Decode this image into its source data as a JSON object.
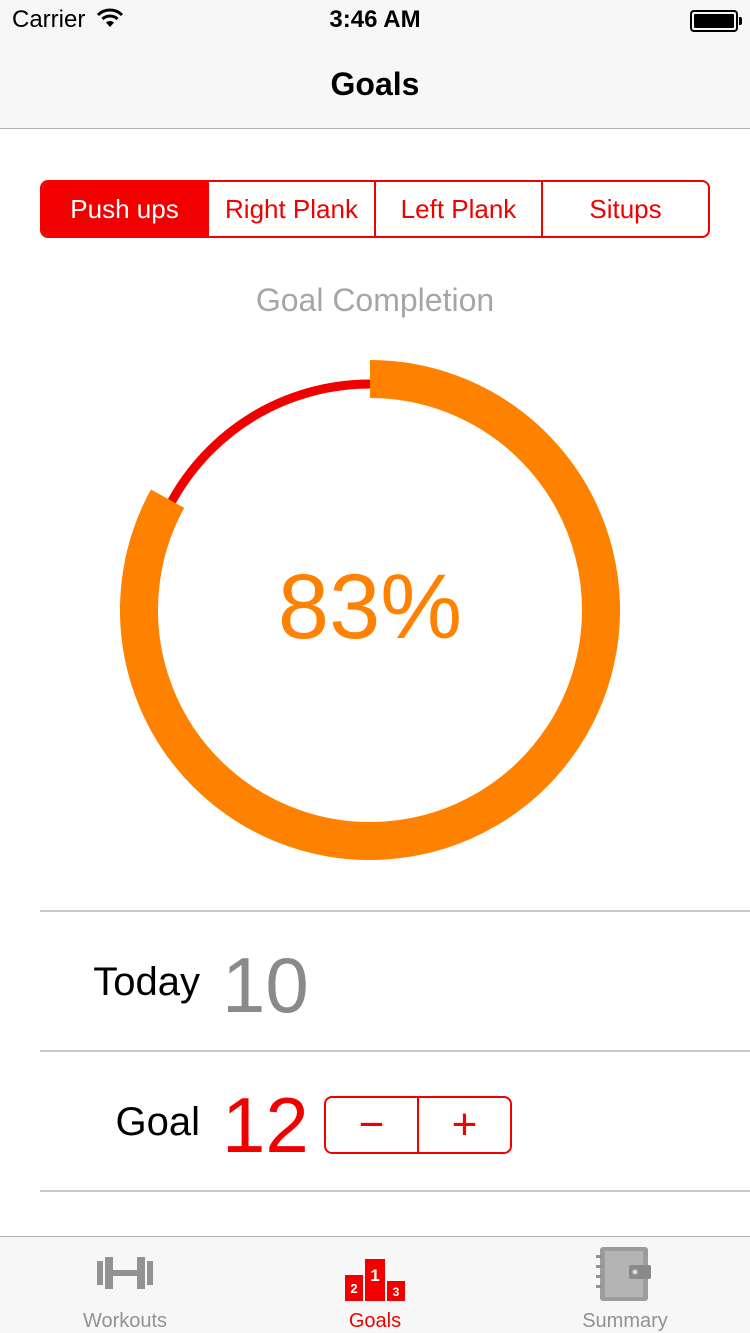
{
  "status_bar": {
    "carrier": "Carrier",
    "time": "3:46 AM"
  },
  "nav": {
    "title": "Goals"
  },
  "segments": [
    {
      "label": "Push ups",
      "selected": true
    },
    {
      "label": "Right Plank",
      "selected": false
    },
    {
      "label": "Left Plank",
      "selected": false
    },
    {
      "label": "Situps",
      "selected": false
    }
  ],
  "goal_completion": {
    "label": "Goal Completion",
    "percent_text": "83%",
    "progress": 0.83,
    "colors": {
      "progress": "#ff8100",
      "remainder": "#f20000"
    }
  },
  "today": {
    "label": "Today",
    "value": "10"
  },
  "goal": {
    "label": "Goal",
    "value": "12",
    "decrement": "−",
    "increment": "+"
  },
  "tabs": [
    {
      "label": "Workouts",
      "icon": "dumbbell-icon",
      "active": false
    },
    {
      "label": "Goals",
      "icon": "podium-icon",
      "active": true
    },
    {
      "label": "Summary",
      "icon": "notebook-icon",
      "active": false
    }
  ],
  "colors": {
    "accent": "#f20000",
    "orange": "#ff8100",
    "gray_text": "#8a8a8a"
  }
}
